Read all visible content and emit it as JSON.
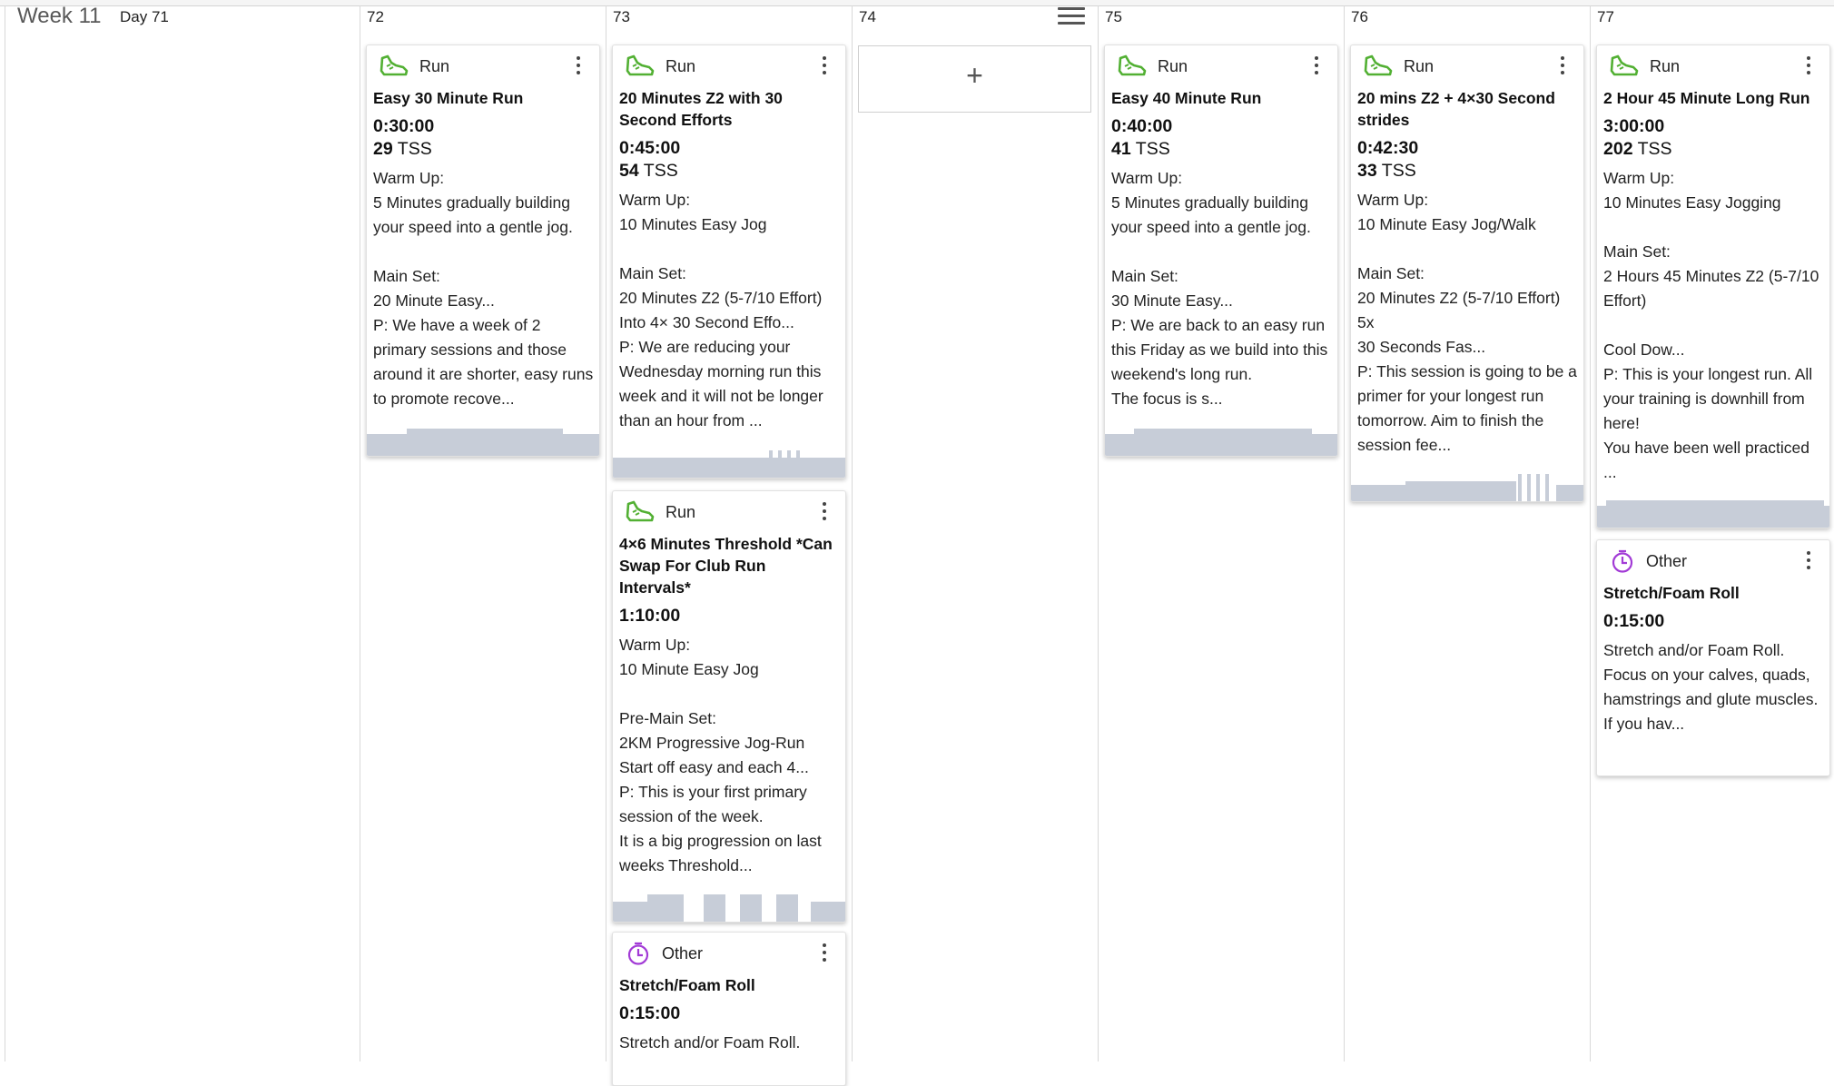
{
  "week": {
    "label": "Week 11",
    "first_day": "Day 71"
  },
  "columns": [
    "72",
    "73",
    "74",
    "75",
    "76",
    "77"
  ],
  "colors": {
    "run_icon": "#52b033",
    "other_icon": "#a23bd6",
    "chart_bar": "#c7cdd8"
  },
  "cards": [
    {
      "type": "Run",
      "icon": "running-shoe-icon",
      "title": "Easy 30 Minute Run",
      "duration": "0:30:00",
      "tss_value": "29",
      "tss_unit": "TSS",
      "description": "Warm Up:\n5 Minutes gradually building your speed into a gentle jog.\n\nMain Set:\n20 Minute Easy...\nP: We have a week of 2 primary sessions and those around it are shorter, easy runs to promote recove..."
    },
    {
      "type": "Run",
      "icon": "running-shoe-icon",
      "title": "20 Minutes Z2 with 30 Second Efforts",
      "duration": "0:45:00",
      "tss_value": "54",
      "tss_unit": "TSS",
      "description": "Warm Up:\n10 Minutes Easy Jog\n\nMain Set:\n20 Minutes Z2 (5-7/10 Effort)\nInto 4× 30 Second Effo...\nP: We are reducing your Wednesday morning run this week and it will not be longer than an hour from ..."
    },
    {
      "type": "Run",
      "icon": "running-shoe-icon",
      "title": "4×6 Minutes Threshold *Can Swap For Club Run Intervals*",
      "duration": "1:10:00",
      "tss_value": "",
      "tss_unit": "",
      "description": "Warm Up:\n10 Minute Easy Jog\n\nPre-Main Set:\n2KM Progressive Jog-Run\nStart off easy and each 4...\nP: This is your first primary session of the week.\nIt is a big progression on last weeks Threshold..."
    },
    {
      "type": "Other",
      "icon": "stopwatch-icon",
      "title": "Stretch/Foam Roll",
      "duration": "0:15:00",
      "tss_value": "",
      "tss_unit": "",
      "description": "Stretch and/or Foam Roll."
    },
    {
      "type": "Run",
      "icon": "running-shoe-icon",
      "title": "Easy 40 Minute Run",
      "duration": "0:40:00",
      "tss_value": "41",
      "tss_unit": "TSS",
      "description": "Warm Up:\n5 Minutes gradually building your speed into a gentle jog.\n\nMain Set:\n30 Minute Easy...\nP: We are back to an easy run this Friday as we build into this weekend's long run.\nThe focus is s..."
    },
    {
      "type": "Run",
      "icon": "running-shoe-icon",
      "title": "20 mins Z2 + 4×30 Second strides",
      "duration": "0:42:30",
      "tss_value": "33",
      "tss_unit": "TSS",
      "description": "Warm Up:\n10 Minute Easy Jog/Walk\n\nMain Set:\n20 Minutes Z2 (5-7/10 Effort)\n5x\n30 Seconds Fas...\nP: This session is going to be a primer for your longest run tomorrow. Aim to finish the session fee..."
    },
    {
      "type": "Run",
      "icon": "running-shoe-icon",
      "title": "2 Hour 45 Minute Long Run",
      "duration": "3:00:00",
      "tss_value": "202",
      "tss_unit": "TSS",
      "description": "Warm Up:\n10 Minutes Easy Jogging\n\nMain Set:\n2 Hours 45 Minutes Z2 (5-7/10 Effort)\n\nCool Dow...\nP: This is your longest run. All your training is downhill from here!\nYou have been well practiced\n..."
    },
    {
      "type": "Other",
      "icon": "stopwatch-icon",
      "title": "Stretch/Foam Roll",
      "duration": "0:15:00",
      "tss_value": "",
      "tss_unit": "",
      "description": "Stretch and/or Foam Roll.\nFocus on your calves, quads, hamstrings and glute muscles.\nIf you hav..."
    }
  ],
  "add_button": {
    "label": "+"
  }
}
